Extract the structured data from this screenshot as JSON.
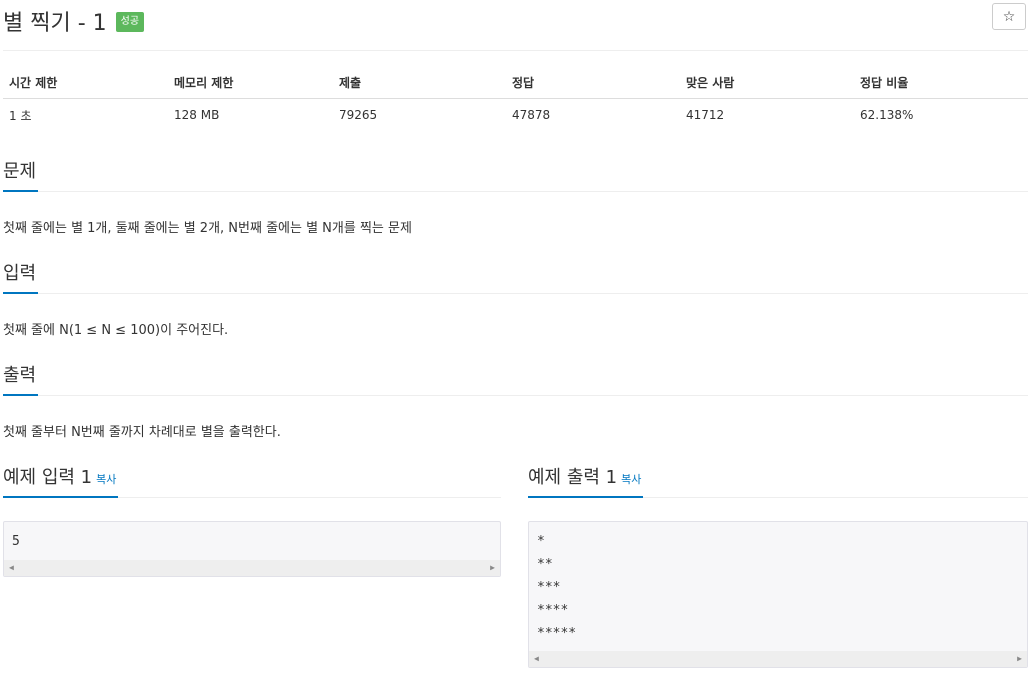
{
  "problem": {
    "title": "별 찍기 - 1",
    "badge": "성공",
    "star_icon": "☆"
  },
  "info": {
    "headers": [
      "시간 제한",
      "메모리 제한",
      "제출",
      "정답",
      "맞은 사람",
      "정답 비율"
    ],
    "values": [
      "1 초",
      "128 MB",
      "79265",
      "47878",
      "41712",
      "62.138%"
    ]
  },
  "sections": {
    "problem": {
      "title": "문제",
      "body": "첫째 줄에는 별 1개, 둘째 줄에는 별 2개, N번째 줄에는 별 N개를 찍는 문제"
    },
    "input": {
      "title": "입력",
      "body": "첫째 줄에 N(1 ≤ N ≤ 100)이 주어진다."
    },
    "output": {
      "title": "출력",
      "body": "첫째 줄부터 N번째 줄까지 차례대로 별을 출력한다."
    }
  },
  "samples": {
    "input": {
      "title": "예제 입력 1",
      "copy": "복사",
      "lines": [
        "5"
      ]
    },
    "output": {
      "title": "예제 출력 1",
      "copy": "복사",
      "lines": [
        "*",
        "**",
        "***",
        "****",
        "*****"
      ]
    }
  },
  "scroll": {
    "left_arrow": "◀",
    "right_arrow": "▶"
  }
}
